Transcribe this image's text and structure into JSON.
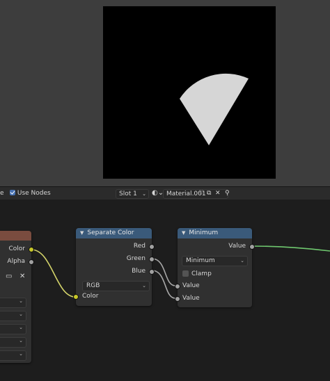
{
  "header": {
    "partial_label": "e",
    "use_nodes_label": "Use Nodes",
    "slot_label": "Slot 1",
    "material_name": "Material.001"
  },
  "left_node": {
    "outputs": [
      "Color",
      "Alpha"
    ]
  },
  "separate_color": {
    "title": "Separate Color",
    "outputs": [
      "Red",
      "Green",
      "Blue"
    ],
    "mode": "RGB",
    "input": "Color"
  },
  "minimum": {
    "title": "Minimum",
    "output": "Value",
    "operation": "Minimum",
    "clamp_label": "Clamp",
    "inputs": [
      "Value",
      "Value"
    ]
  },
  "colors": {
    "node_header": "#3a5a7a",
    "color_socket": "#c7c729",
    "value_socket": "#a1a1a1",
    "accent": "#4772b3"
  }
}
